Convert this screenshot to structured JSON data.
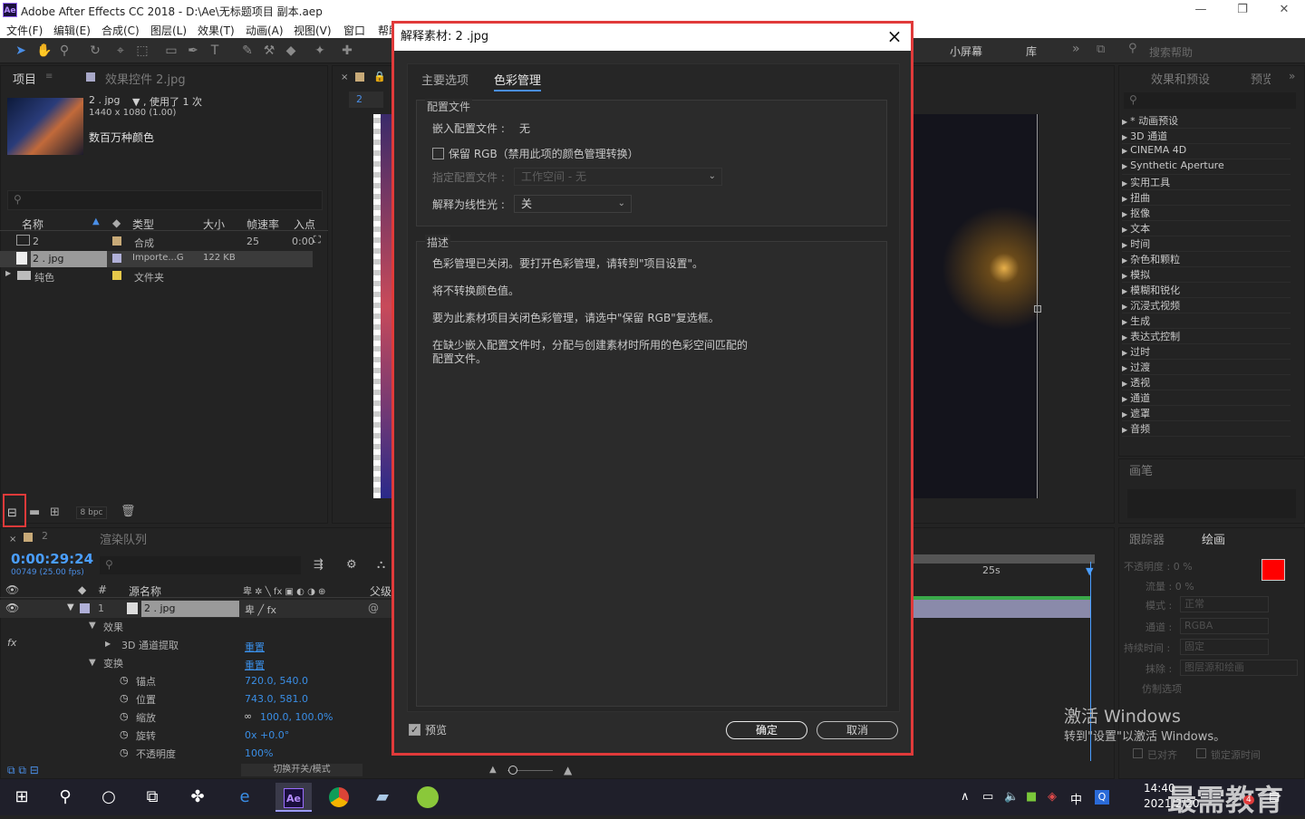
{
  "window": {
    "title": "Adobe After Effects CC 2018 - D:\\Ae\\无标题项目 副本.aep",
    "logo": "Ae",
    "minimize": "—",
    "maximize": "❐",
    "close": "✕"
  },
  "menu": [
    "文件(F)",
    "编辑(E)",
    "合成(C)",
    "图层(L)",
    "效果(T)",
    "动画(A)",
    "视图(V)",
    "窗口",
    "帮助"
  ],
  "workspace": {
    "small_screen": "小屏幕",
    "library": "库",
    "search_placeholder": "搜索帮助"
  },
  "project": {
    "tab_project": "项目",
    "tab_effects": "效果控件 2.jpg",
    "item_name": "2 . jpg",
    "used": "▼ , 使用了 1 次",
    "dims": "1440 x 1080 (1.00)",
    "colors": "数百万种颜色",
    "col_name": "名称",
    "col_type": "类型",
    "col_size": "大小",
    "col_fps": "帧速率",
    "col_in": "入点",
    "rows": [
      {
        "name": "2",
        "type": "合成",
        "size": "",
        "fps": "25",
        "in": "0:00"
      },
      {
        "name": "2 . jpg",
        "type": "Importe...G",
        "size": "122 KB",
        "fps": "",
        "in": ""
      },
      {
        "name": "纯色",
        "type": "文件夹",
        "size": "",
        "fps": "",
        "in": ""
      }
    ],
    "bpc": "8 bpc"
  },
  "comp": {
    "tab": "2"
  },
  "effects_panel": {
    "tab1": "效果和预设",
    "tab2": "预览",
    "items": [
      "* 动画预设",
      "3D 通道",
      "CINEMA 4D",
      "Synthetic Aperture",
      "实用工具",
      "扭曲",
      "抠像",
      "文本",
      "时间",
      "杂色和颗粒",
      "模拟",
      "模糊和锐化",
      "沉浸式视频",
      "生成",
      "表达式控制",
      "过时",
      "过渡",
      "透视",
      "通道",
      "遮罩",
      "音频"
    ]
  },
  "brush": {
    "tab": "画笔"
  },
  "timeline": {
    "tab_render": "渲染队列",
    "tab_comp": "2",
    "timecode": "0:00:29:24",
    "frames": "00749 (25.00 fps)",
    "col_source": "源名称",
    "col_parent": "父级",
    "layer_num": "1",
    "layer_name": "2 . jpg",
    "effects": "效果",
    "effect_name": "3D 通道提取",
    "reset": "重置",
    "transform": "变换",
    "reset2": "重置",
    "props": [
      {
        "name": "锚点",
        "value": "720.0, 540.0"
      },
      {
        "name": "位置",
        "value": "743.0, 581.0"
      },
      {
        "name": "缩放",
        "value": "100.0, 100.0%"
      },
      {
        "name": "旋转",
        "value": "0x +0.0°"
      },
      {
        "name": "不透明度",
        "value": "100%"
      }
    ],
    "toggle": "切换开关/模式",
    "ruler_25": "25s"
  },
  "tracker": {
    "tab1": "跟踪器",
    "tab2": "绘画",
    "opacity": "不透明度 : 0 %",
    "flow": "流量 : 0 %",
    "mode_label": "模式 :",
    "mode": "正常",
    "channel_label": "通道 :",
    "channel": "RGBA",
    "duration_label": "持续时间 :",
    "duration": "固定",
    "erase_label": "抹除 :",
    "erase": "图层源和绘画",
    "clone": "仿制选项",
    "aligned": "已对齐",
    "lock_time": "锁定源时间",
    "activate1": "激活 Windows",
    "activate2": "转到\"设置\"以激活 Windows。"
  },
  "dialog": {
    "title": "解释素材: 2 .jpg",
    "tab_main": "主要选项",
    "tab_color": "色彩管理",
    "profile_header": "配置文件",
    "embedded_label": "嵌入配置文件 :",
    "embedded_value": "无",
    "preserve_rgb": "保留 RGB（禁用此项的颜色管理转换）",
    "assign_label": "指定配置文件 :",
    "assign_value": "工作空间 - 无",
    "linear_label": "解释为线性光 :",
    "linear_value": "关",
    "desc_header": "描述",
    "desc1": "色彩管理已关闭。要打开色彩管理，请转到\"项目设置\"。",
    "desc2": "将不转换颜色值。",
    "desc3": "要为此素材项目关闭色彩管理，请选中\"保留 RGB\"复选框。",
    "desc4a": "在缺少嵌入配置文件时，分配与创建素材时所用的色彩空间匹配的",
    "desc4b": "配置文件。",
    "preview": "预览",
    "ok": "确定",
    "cancel": "取消"
  },
  "taskbar": {
    "time": "14:40",
    "date": "2021/2/20",
    "ime": "中",
    "watermark": "最需教育",
    "ae": "Ae",
    "notif": "4"
  }
}
